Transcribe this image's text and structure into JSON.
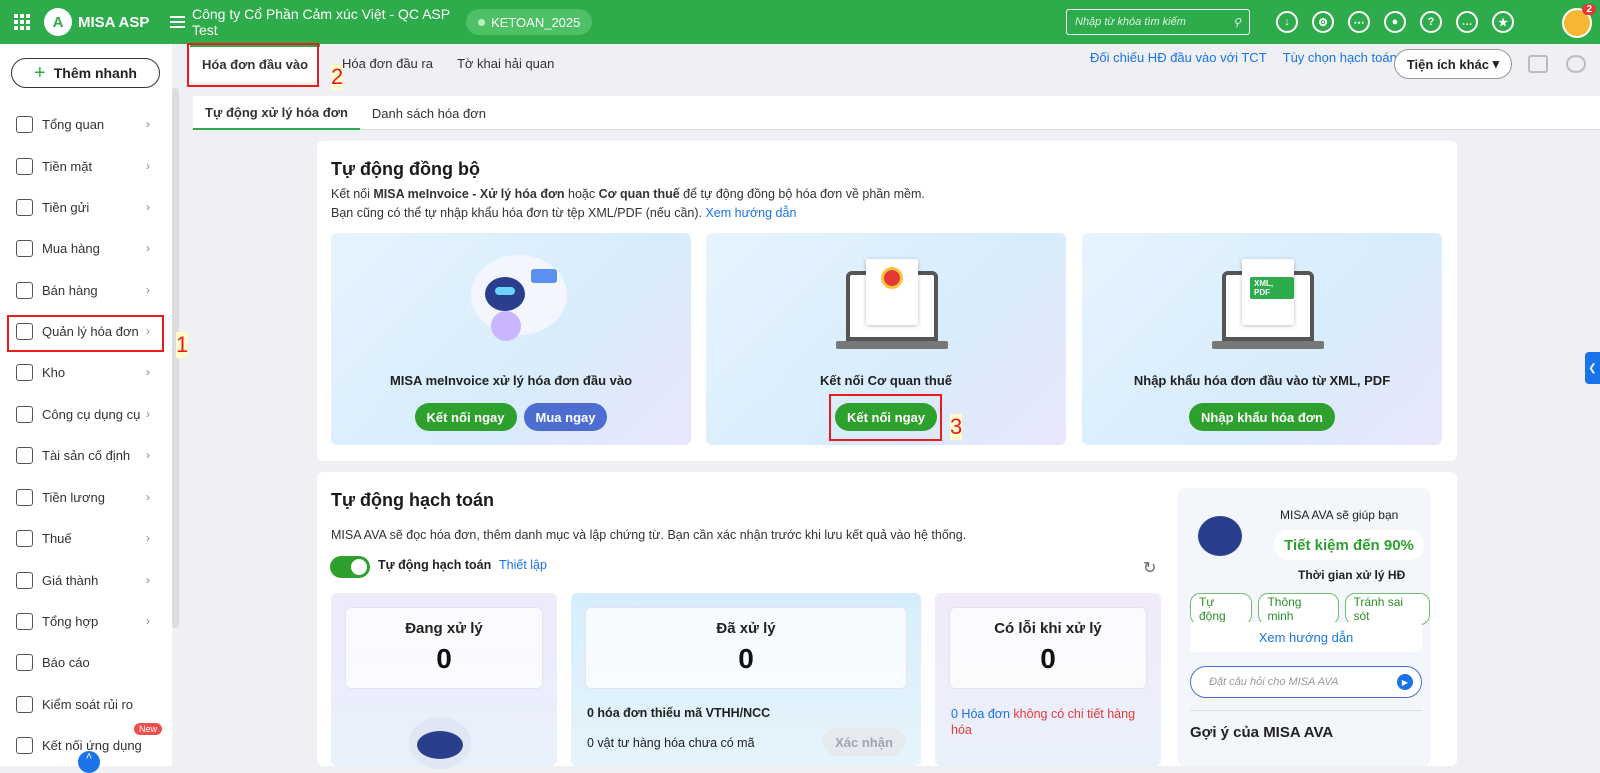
{
  "topbar": {
    "brand": "MISA ASP",
    "company": "Công ty Cổ Phần Cảm xúc Việt - QC ASP Test",
    "database": "KETOAN_2025",
    "search_placeholder": "Nhập từ khóa tìm kiếm",
    "notification_count": "2"
  },
  "sidebar": {
    "add_label": "Thêm nhanh",
    "items": [
      {
        "label": "Tổng quan",
        "icon": "dashboard-icon"
      },
      {
        "label": "Tiền mặt",
        "icon": "cash-icon"
      },
      {
        "label": "Tiền gửi",
        "icon": "bank-icon"
      },
      {
        "label": "Mua hàng",
        "icon": "shopping-bag-icon"
      },
      {
        "label": "Bán hàng",
        "icon": "cart-icon"
      },
      {
        "label": "Quản lý hóa đơn",
        "icon": "invoice-icon"
      },
      {
        "label": "Kho",
        "icon": "warehouse-icon"
      },
      {
        "label": "Công cụ dụng cụ",
        "icon": "tools-icon"
      },
      {
        "label": "Tài sản cố định",
        "icon": "car-icon"
      },
      {
        "label": "Tiền lương",
        "icon": "payroll-icon"
      },
      {
        "label": "Thuế",
        "icon": "tax-icon"
      },
      {
        "label": "Giá thành",
        "icon": "price-tag-icon"
      },
      {
        "label": "Tổng hợp",
        "icon": "summary-icon"
      },
      {
        "label": "Báo cáo",
        "icon": "report-icon"
      },
      {
        "label": "Kiểm soát rủi ro",
        "icon": "risk-icon"
      },
      {
        "label": "Kết nối ứng dụng",
        "icon": "connect-icon"
      }
    ],
    "new_badge": "New"
  },
  "annotations": {
    "one": "1",
    "two": "2",
    "three": "3"
  },
  "tabs": {
    "main": [
      "Hóa đơn đầu vào",
      "Hóa đơn đầu ra",
      "Tờ khai hải quan"
    ],
    "sub": [
      "Tự động xử lý hóa đơn",
      "Danh sách hóa đơn"
    ]
  },
  "right_links": {
    "compare": "Đối chiếu HĐ đầu vào với TCT",
    "options": "Tùy chọn hạch toán",
    "utility": "Tiện ích khác"
  },
  "sync": {
    "title": "Tự động đồng bộ",
    "desc_prefix": "Kết nối ",
    "desc_bold1": "MISA meInvoice - Xử lý hóa đơn",
    "desc_mid": " hoặc ",
    "desc_bold2": "Cơ quan thuế",
    "desc_suffix": " để tự động đồng bộ hóa đơn về phần mềm.",
    "desc2": "Bạn cũng có thể tự nhập khẩu hóa đơn từ tệp XML/PDF (nếu cần).",
    "guide": "Xem hướng dẫn",
    "options": [
      {
        "title": "MISA meInvoice xử lý hóa đơn đầu vào",
        "btn1": "Kết nối ngay",
        "btn2": "Mua ngay"
      },
      {
        "title": "Kết nối Cơ quan thuế",
        "btn1": "Kết nối ngay"
      },
      {
        "title": "Nhập khẩu hóa đơn đầu vào từ XML, PDF",
        "btn1": "Nhập khẩu hóa đơn",
        "tag": "XML, PDF"
      }
    ]
  },
  "accounting": {
    "title": "Tự động hạch toán",
    "desc": "MISA AVA sẽ đọc hóa đơn, thêm danh mục và lập chứng từ. Bạn cần xác nhận trước khi lưu kết quả vào hệ thống.",
    "toggle_label": "Tự động hạch toán",
    "setup": "Thiết lập",
    "stats": [
      {
        "label": "Đang xử lý",
        "value": "0"
      },
      {
        "label": "Đã xử lý",
        "value": "0"
      },
      {
        "label": "Có lỗi khi xử lý",
        "value": "0"
      }
    ],
    "missing": "0 hóa đơn thiếu mã VTHH/NCC",
    "missing_items": "0 vật tư hàng hóa chưa có mã",
    "confirm": "Xác nhận",
    "error_count": "0 Hóa đơn",
    "error_text": " không có chi tiết hàng hóa"
  },
  "ava": {
    "line1": "MISA AVA sẽ giúp bạn",
    "highlight": "Tiết kiệm đến 90%",
    "line2": "Thời gian xử lý HĐ",
    "chips": [
      "Tự động",
      "Thông minh",
      "Tránh sai sót"
    ],
    "guide": "Xem hướng dẫn",
    "ask_placeholder": "Đặt câu hỏi cho MISA AVA",
    "suggest": "Gợi ý của MISA AVA"
  },
  "colors": {
    "brand": "#2eab4a",
    "link": "#1a73e8",
    "annotation": "#e81c1c"
  }
}
